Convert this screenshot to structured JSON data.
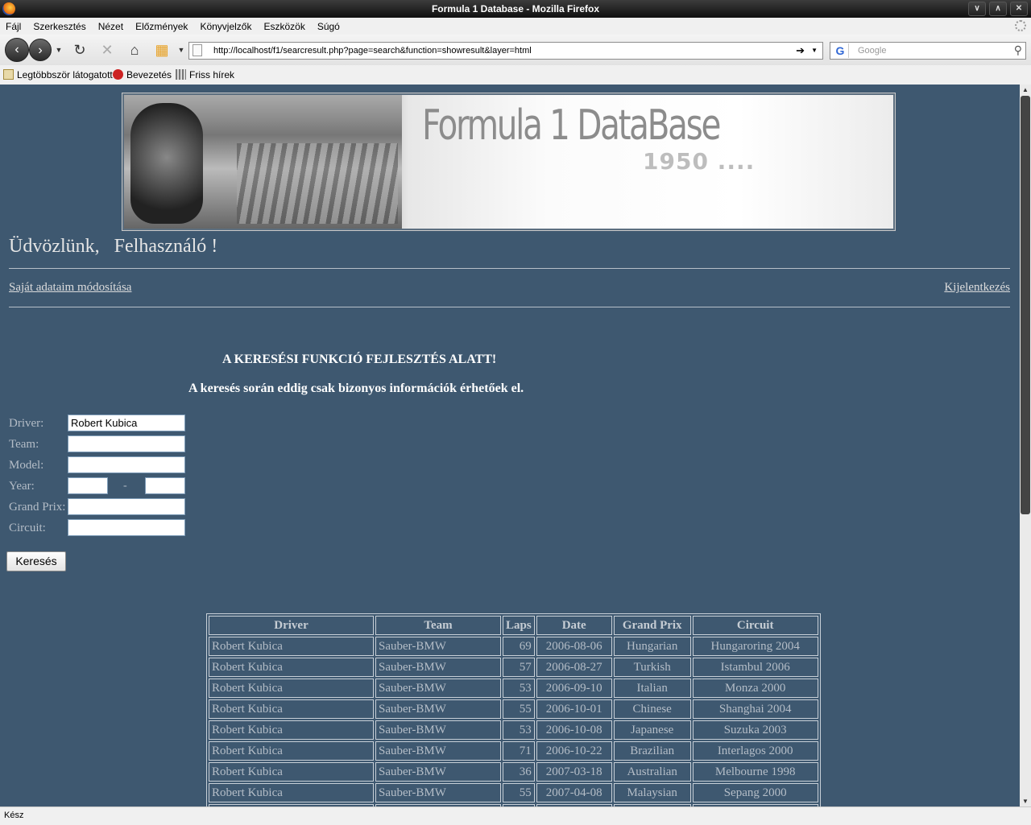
{
  "window": {
    "title": "Formula 1 Database - Mozilla Firefox"
  },
  "menu": [
    "Fájl",
    "Szerkesztés",
    "Nézet",
    "Előzmények",
    "Könyvjelzők",
    "Eszközök",
    "Súgó"
  ],
  "navigation": {
    "url": "http://localhost/f1/searcresult.php?page=search&function=showresult&layer=html",
    "search_placeholder": "Google"
  },
  "bookmarks": [
    "Legtöbbször látogatott",
    "Bevezetés",
    "Friss hírek"
  ],
  "banner": {
    "title": "Formula 1 DataBase",
    "subtitle": "1950 ...."
  },
  "welcome": {
    "greeting": "Üdvözlünk,",
    "user": "Felhasználó !"
  },
  "links": {
    "my_data": "Saját adataim módosítása",
    "logout": "Kijelentkezés"
  },
  "notice": {
    "line1": "A KERESÉSI FUNKCIÓ FEJLESZTÉS ALATT!",
    "line2": "A keresés során eddig csak bizonyos információk érhetőek el."
  },
  "form": {
    "driver_label": "Driver:",
    "driver_value": "Robert Kubica",
    "team_label": "Team:",
    "team_value": "",
    "model_label": "Model:",
    "model_value": "",
    "year_label": "Year:",
    "year_from": "",
    "year_sep": "-",
    "year_to": "",
    "grandprix_label": "Grand Prix:",
    "grandprix_value": "",
    "circuit_label": "Circuit:",
    "circuit_value": "",
    "submit": "Keresés"
  },
  "results": {
    "headers": [
      "Driver",
      "Team",
      "Laps",
      "Date",
      "Grand Prix",
      "Circuit"
    ],
    "rows": [
      [
        "Robert Kubica",
        "Sauber-BMW",
        "69",
        "2006-08-06",
        "Hungarian",
        "Hungaroring 2004"
      ],
      [
        "Robert Kubica",
        "Sauber-BMW",
        "57",
        "2006-08-27",
        "Turkish",
        "Istambul 2006"
      ],
      [
        "Robert Kubica",
        "Sauber-BMW",
        "53",
        "2006-09-10",
        "Italian",
        "Monza 2000"
      ],
      [
        "Robert Kubica",
        "Sauber-BMW",
        "55",
        "2006-10-01",
        "Chinese",
        "Shanghai 2004"
      ],
      [
        "Robert Kubica",
        "Sauber-BMW",
        "53",
        "2006-10-08",
        "Japanese",
        "Suzuka 2003"
      ],
      [
        "Robert Kubica",
        "Sauber-BMW",
        "71",
        "2006-10-22",
        "Brazilian",
        "Interlagos 2000"
      ],
      [
        "Robert Kubica",
        "Sauber-BMW",
        "36",
        "2007-03-18",
        "Australian",
        "Melbourne 1998"
      ],
      [
        "Robert Kubica",
        "Sauber-BMW",
        "55",
        "2007-04-08",
        "Malaysian",
        "Sepang 2000"
      ]
    ]
  },
  "status": {
    "text": "Kész"
  }
}
